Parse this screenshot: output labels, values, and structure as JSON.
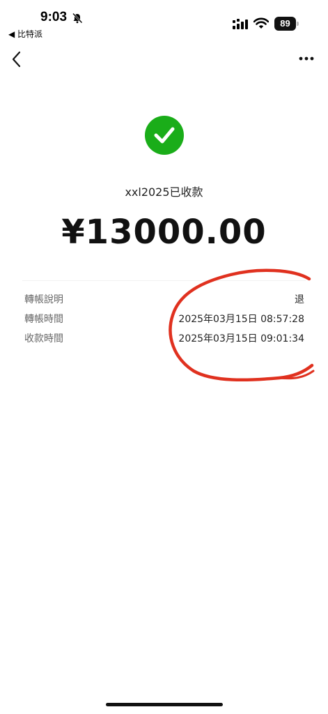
{
  "status_bar": {
    "time": "9:03",
    "back_app": "◀ 比特派",
    "battery": "89"
  },
  "payment": {
    "payee": "xxl2025已收款",
    "amount": "¥13000.00"
  },
  "details": [
    {
      "label": "轉帳說明",
      "value": "退"
    },
    {
      "label": "轉帳時間",
      "value": "2025年03月15日 08:57:28"
    },
    {
      "label": "收款時間",
      "value": "2025年03月15日 09:01:34"
    }
  ],
  "icons": {
    "bell": "bell-slash-icon",
    "signal": "signal-icon",
    "wifi": "wifi-icon",
    "battery": "battery-icon",
    "back": "chevron-left-icon",
    "more": "more-dots-icon",
    "success": "check-circle-icon"
  },
  "colors": {
    "success_green": "#1aad19",
    "annotation_red": "#e0311f"
  }
}
